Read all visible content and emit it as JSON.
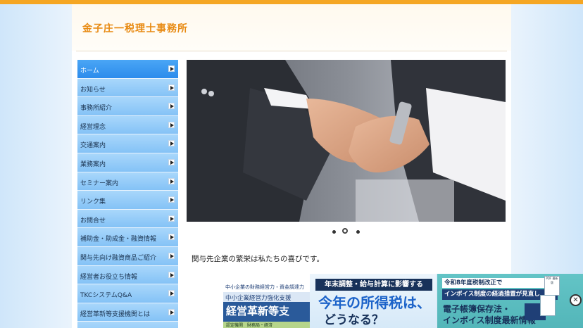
{
  "site": {
    "title": "金子庄一税理士事務所"
  },
  "sidebar": {
    "items": [
      {
        "label": "ホーム"
      },
      {
        "label": "お知らせ"
      },
      {
        "label": "事務所紹介"
      },
      {
        "label": "経営理念"
      },
      {
        "label": "交通案内"
      },
      {
        "label": "業務案内"
      },
      {
        "label": "セミナー案内"
      },
      {
        "label": "リンク集"
      },
      {
        "label": "お問合せ"
      },
      {
        "label": "補助金・助成金・融資情報"
      },
      {
        "label": "関与先向け融資商品ご紹介"
      },
      {
        "label": "経営者お役立ち情報"
      },
      {
        "label": "TKCシステムQ&A"
      },
      {
        "label": "経営革新等支援機関とは"
      }
    ]
  },
  "slider": {
    "slide_count": 3,
    "current_index": 1
  },
  "main": {
    "welcome_text": "関与先企業の繁栄は私たちの喜びです。"
  },
  "banner": {
    "line1": "中小企業の財務経営力・資金調達力",
    "line2": "中小企業経営力強化支援",
    "main": "経営革新等支",
    "foot": "認定機関　財務局・経済"
  },
  "ad": {
    "panel1_top": "年末調整・給与計算に影響する",
    "panel1_big": "今年の所得税は、",
    "panel1_big2": "どうなる？",
    "panel2_line1": "令和8年度税制改正で",
    "panel2_line2": "インボイス制度の経過措置が見直し",
    "panel2_line3": "電子帳簿保存法・",
    "panel2_line4": "インボイス制度最新情報",
    "doc_label": "PDF 最新版",
    "close_symbol": "✕"
  },
  "colors": {
    "accent_orange": "#f5a623",
    "title_orange": "#e88a12",
    "nav_active": "#2c8cec",
    "nav_bg": "#84c2f6"
  }
}
